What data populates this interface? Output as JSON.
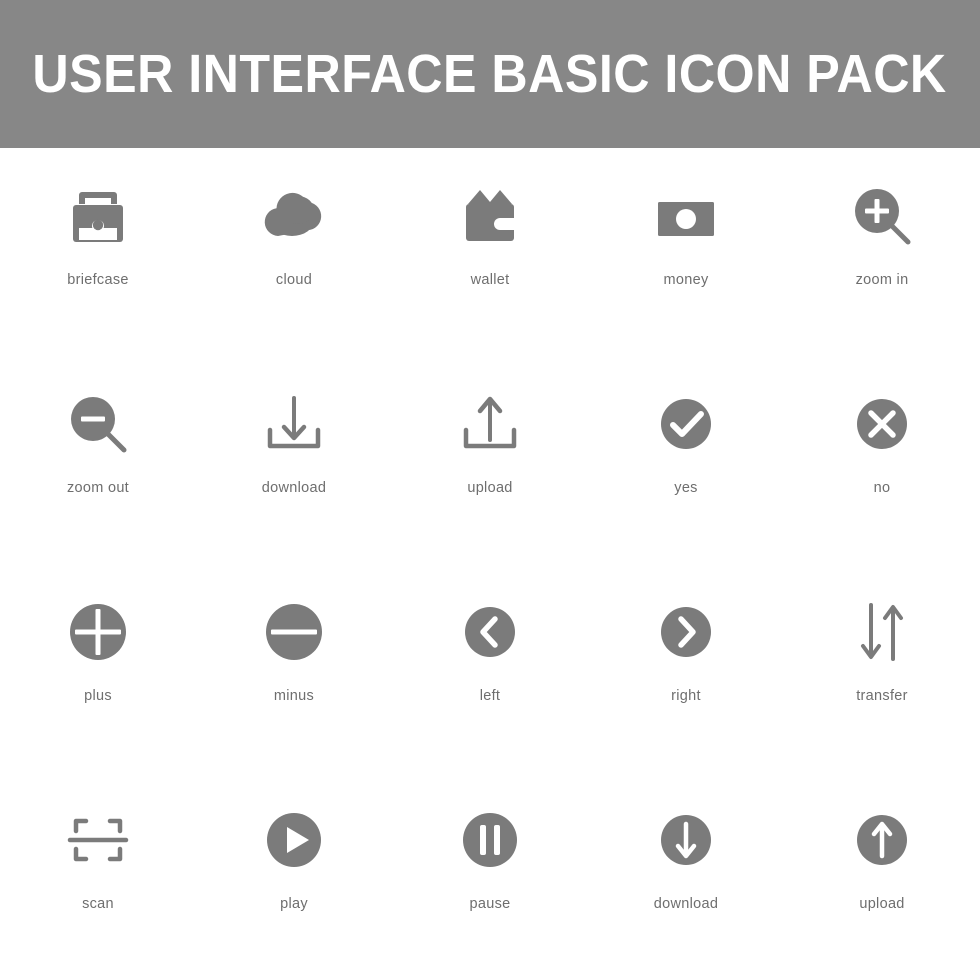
{
  "header": {
    "title": "USER INTERFACE BASIC ICON PACK",
    "background_color": "#878787",
    "text_color": "#ffffff"
  },
  "style": {
    "icon_color": "#7b7b7b",
    "label_color": "#6e6e6e",
    "page_background": "#ffffff"
  },
  "grid": {
    "columns": 5,
    "rows": 4,
    "total_icons": 20
  },
  "icons": [
    {
      "id": "briefcase",
      "label": "briefcase",
      "icon": "briefcase-icon",
      "row": 1,
      "col": 1,
      "style": "solid"
    },
    {
      "id": "cloud",
      "label": "cloud",
      "icon": "cloud-icon",
      "row": 1,
      "col": 2,
      "style": "solid"
    },
    {
      "id": "wallet",
      "label": "wallet",
      "icon": "wallet-icon",
      "row": 1,
      "col": 3,
      "style": "solid"
    },
    {
      "id": "money",
      "label": "money",
      "icon": "money-icon",
      "row": 1,
      "col": 4,
      "style": "solid"
    },
    {
      "id": "zoom-in",
      "label": "zoom in",
      "icon": "zoom-in-icon",
      "row": 1,
      "col": 5,
      "style": "solid"
    },
    {
      "id": "zoom-out",
      "label": "zoom out",
      "icon": "zoom-out-icon",
      "row": 2,
      "col": 1,
      "style": "solid"
    },
    {
      "id": "download-tray",
      "label": "download",
      "icon": "download-tray-icon",
      "row": 2,
      "col": 2,
      "style": "line"
    },
    {
      "id": "upload-tray",
      "label": "upload",
      "icon": "upload-tray-icon",
      "row": 2,
      "col": 3,
      "style": "line"
    },
    {
      "id": "yes",
      "label": "yes",
      "icon": "check-circle-icon",
      "row": 2,
      "col": 4,
      "style": "solid"
    },
    {
      "id": "no",
      "label": "no",
      "icon": "close-circle-icon",
      "row": 2,
      "col": 5,
      "style": "solid"
    },
    {
      "id": "plus",
      "label": "plus",
      "icon": "plus-circle-icon",
      "row": 3,
      "col": 1,
      "style": "solid"
    },
    {
      "id": "minus",
      "label": "minus",
      "icon": "minus-circle-icon",
      "row": 3,
      "col": 2,
      "style": "solid"
    },
    {
      "id": "left",
      "label": "left",
      "icon": "chevron-left-icon",
      "row": 3,
      "col": 3,
      "style": "solid"
    },
    {
      "id": "right",
      "label": "right",
      "icon": "chevron-right-icon",
      "row": 3,
      "col": 4,
      "style": "solid"
    },
    {
      "id": "transfer",
      "label": "transfer",
      "icon": "transfer-icon",
      "row": 3,
      "col": 5,
      "style": "line"
    },
    {
      "id": "scan",
      "label": "scan",
      "icon": "scan-icon",
      "row": 4,
      "col": 1,
      "style": "line"
    },
    {
      "id": "play",
      "label": "play",
      "icon": "play-circle-icon",
      "row": 4,
      "col": 2,
      "style": "solid"
    },
    {
      "id": "pause",
      "label": "pause",
      "icon": "pause-circle-icon",
      "row": 4,
      "col": 3,
      "style": "solid"
    },
    {
      "id": "download-circle",
      "label": "download",
      "icon": "download-circle-icon",
      "row": 4,
      "col": 4,
      "style": "solid"
    },
    {
      "id": "upload-circle",
      "label": "upload",
      "icon": "upload-circle-icon",
      "row": 4,
      "col": 5,
      "style": "solid"
    }
  ]
}
